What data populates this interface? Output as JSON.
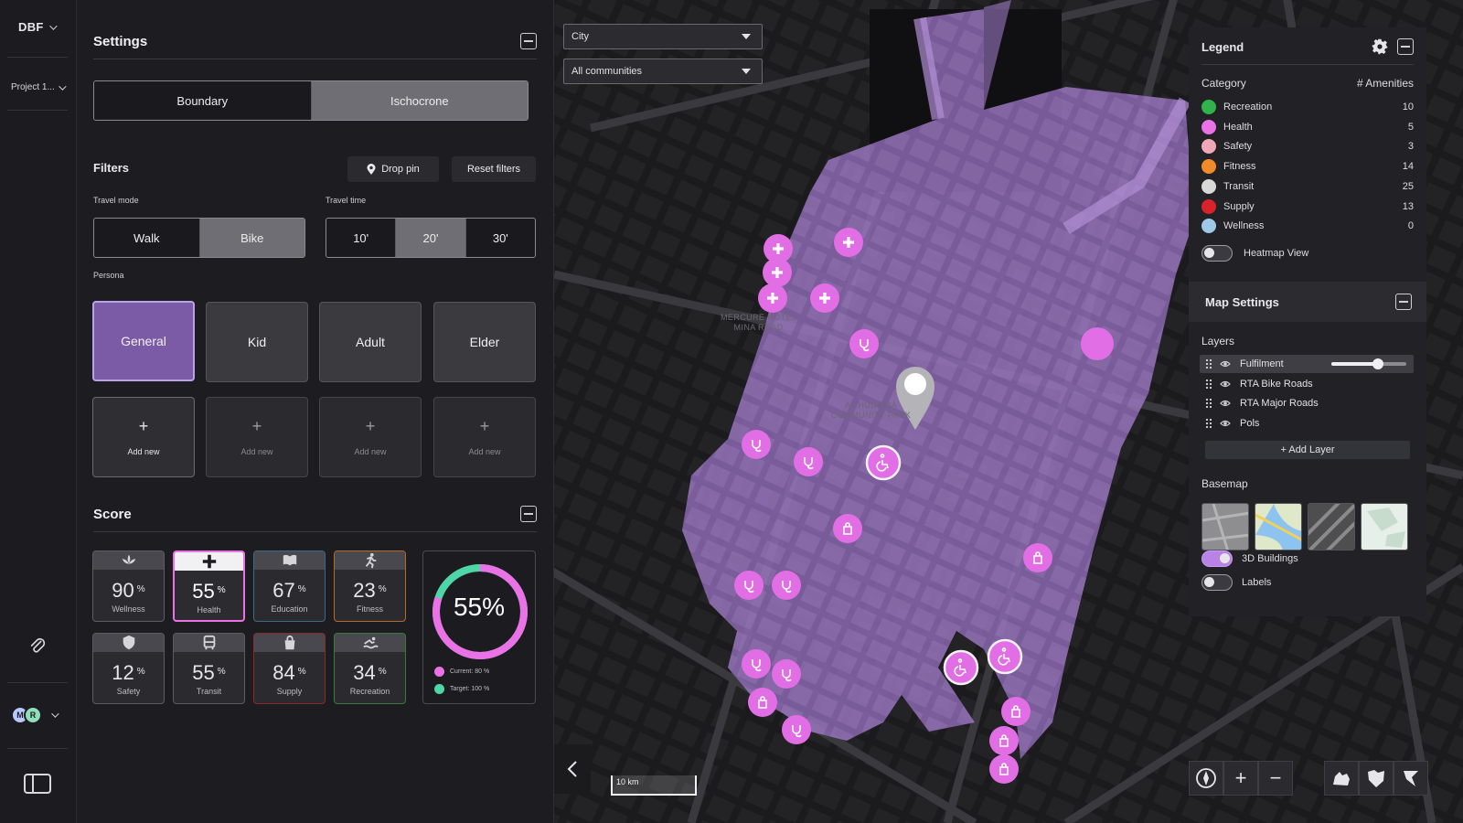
{
  "rail": {
    "brand": "DBF",
    "project": "Project 1...",
    "avatars": [
      "M",
      "R"
    ]
  },
  "settings": {
    "title": "Settings",
    "mode_tabs": [
      "Boundary",
      "Ischocrone"
    ],
    "mode_selected": "Ischocrone",
    "filters_title": "Filters",
    "drop_pin": "Drop pin",
    "reset_filters": "Reset filters",
    "travel_mode_label": "Travel mode",
    "travel_modes": [
      "Walk",
      "Bike"
    ],
    "travel_mode_selected": "Bike",
    "travel_time_label": "Travel time",
    "travel_times": [
      "10'",
      "20'",
      "30'"
    ],
    "travel_time_selected": "20'",
    "persona_label": "Persona",
    "personas": [
      "General",
      "Kid",
      "Adult",
      "Elder"
    ],
    "persona_selected": "General",
    "add_new": "Add new"
  },
  "score": {
    "title": "Score",
    "items": [
      {
        "name": "Wellness",
        "value": "90",
        "unit": "%",
        "icon": "lotus-icon",
        "border": "#5d5d63"
      },
      {
        "name": "Health",
        "value": "55",
        "unit": "%",
        "icon": "plus-icon",
        "border": "#ea72e6"
      },
      {
        "name": "Education",
        "value": "67",
        "unit": "%",
        "icon": "book-icon",
        "border": "#3f6a86"
      },
      {
        "name": "Fitness",
        "value": "23",
        "unit": "%",
        "icon": "runner-icon",
        "border": "#b56a2a"
      },
      {
        "name": "Safety",
        "value": "12",
        "unit": "%",
        "icon": "shield-icon",
        "border": "#5d5d63"
      },
      {
        "name": "Transit",
        "value": "55",
        "unit": "%",
        "icon": "bus-icon",
        "border": "#5d5d63"
      },
      {
        "name": "Supply",
        "value": "84",
        "unit": "%",
        "icon": "bag-icon",
        "border": "#8f2a2a"
      },
      {
        "name": "Recreation",
        "value": "34",
        "unit": "%",
        "icon": "swimmer-icon",
        "border": "#3b7a3b"
      }
    ],
    "gauge": {
      "value_text": "55%",
      "current_fraction": 0.8,
      "target_fraction": 1.0,
      "current_label": "Current: 80 %",
      "target_label": "Target: 100 %",
      "current_color": "#ea72e6",
      "target_color": "#4fd6a8"
    }
  },
  "map": {
    "city_select": "City",
    "community_select": "All communities",
    "place_labels": [
      "MERCURE HOTEL\nMINA ROAD",
      "AL HUDAIBA\nCOMMUNITY PARK"
    ],
    "scale_label": "10 km",
    "isochrone_color": "#a07ac8"
  },
  "legend": {
    "title": "Legend",
    "col_category": "Category",
    "col_amenities": "# Amenities",
    "categories": [
      {
        "name": "Recreation",
        "count": "10",
        "color": "#2fb34a"
      },
      {
        "name": "Health",
        "count": "5",
        "color": "#ea72e6"
      },
      {
        "name": "Safety",
        "count": "3",
        "color": "#f0a8b8"
      },
      {
        "name": "Fitness",
        "count": "14",
        "color": "#f08a2a"
      },
      {
        "name": "Transit",
        "count": "25",
        "color": "#d8d8d8"
      },
      {
        "name": "Supply",
        "count": "13",
        "color": "#d8232a"
      },
      {
        "name": "Wellness",
        "count": "0",
        "color": "#9ec8e8"
      }
    ],
    "heatmap_label": "Heatmap View",
    "heatmap_on": false
  },
  "map_settings": {
    "title": "Map Settings",
    "layers_label": "Layers",
    "layers": [
      "Fulfilment",
      "RTA Bike Roads",
      "RTA Major Roads",
      "Pols"
    ],
    "fulfilment_opacity": 0.62,
    "add_layer": "+ Add Layer",
    "basemap_label": "Basemap",
    "buildings_label": "3D Buildings",
    "buildings_on": true,
    "labels_label": "Labels",
    "labels_on": false
  }
}
